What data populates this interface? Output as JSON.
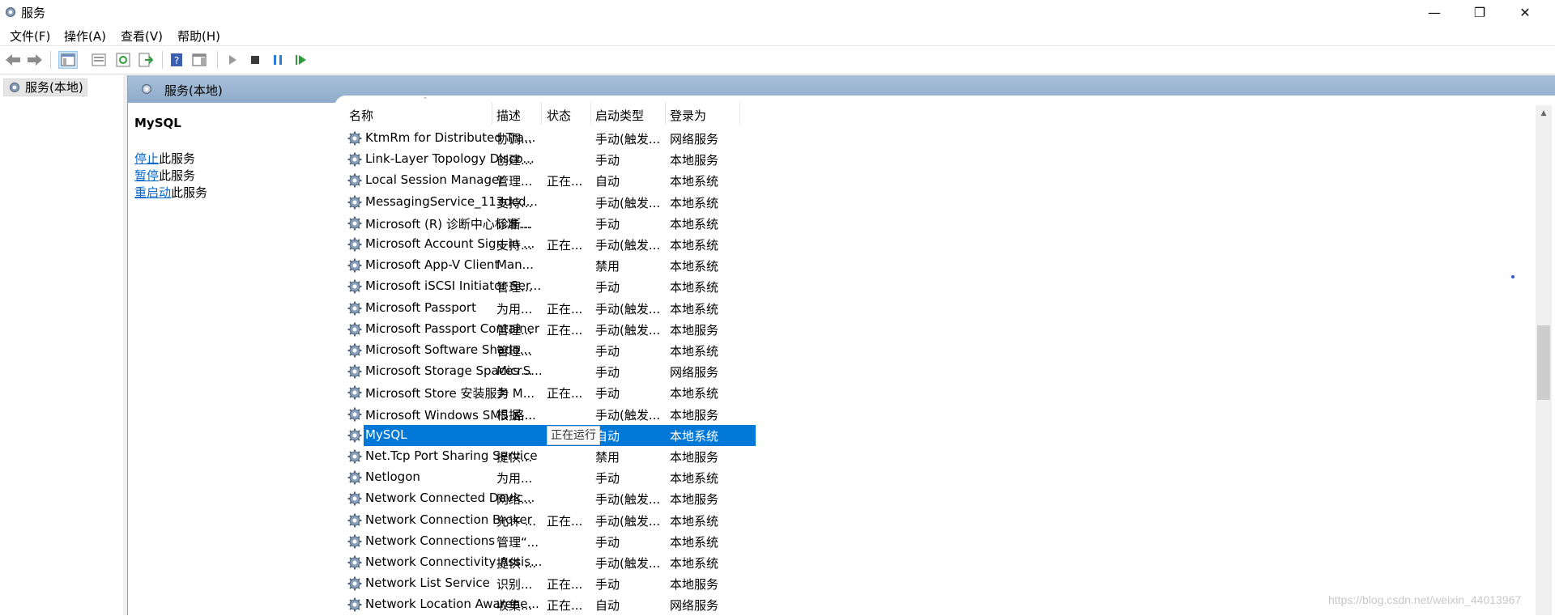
{
  "window": {
    "title": "服务",
    "min_icon": "minimize-icon",
    "max_icon": "restore-icon",
    "close_icon": "close-icon"
  },
  "menu": [
    "文件(F)",
    "操作(A)",
    "查看(V)",
    "帮助(H)"
  ],
  "toolbar_icons": [
    "back-arrow-icon",
    "forward-arrow-icon",
    "show-hide-console-tree-icon",
    "properties-icon",
    "refresh-icon",
    "export-list-icon",
    "help-icon",
    "show-action-pane-icon",
    "start-service-icon",
    "stop-service-icon",
    "pause-service-icon",
    "restart-service-icon"
  ],
  "tree": {
    "node_label": "服务(本地)"
  },
  "main": {
    "header_title": "服务(本地)",
    "selected_service_title": "MySQL",
    "actions": [
      {
        "link": "停止",
        "suffix": "此服务"
      },
      {
        "link": "暂停",
        "suffix": "此服务"
      },
      {
        "link": "重启动",
        "suffix": "此服务"
      }
    ]
  },
  "columns": [
    "名称",
    "描述",
    "状态",
    "启动类型",
    "登录为"
  ],
  "rows": [
    {
      "name": "KtmRm for Distributed Tra...",
      "desc": "协调...",
      "status": "",
      "start": "手动(触发...",
      "logon": "网络服务"
    },
    {
      "name": "Link-Layer Topology Disco...",
      "desc": "创建...",
      "status": "",
      "start": "手动",
      "logon": "本地服务"
    },
    {
      "name": "Local Session Manager",
      "desc": "管理...",
      "status": "正在...",
      "start": "自动",
      "logon": "本地系统"
    },
    {
      "name": "MessagingService_113dcd...",
      "desc": "支持...",
      "status": "",
      "start": "手动(触发...",
      "logon": "本地系统"
    },
    {
      "name": "Microsoft (R) 诊断中心标准...",
      "desc": "诊断...",
      "status": "",
      "start": "手动",
      "logon": "本地系统"
    },
    {
      "name": "Microsoft Account Sign-in ...",
      "desc": "支持...",
      "status": "正在...",
      "start": "手动(触发...",
      "logon": "本地系统"
    },
    {
      "name": "Microsoft App-V Client",
      "desc": "Man...",
      "status": "",
      "start": "禁用",
      "logon": "本地系统"
    },
    {
      "name": "Microsoft iSCSI Initiator Ser...",
      "desc": "管理...",
      "status": "",
      "start": "手动",
      "logon": "本地系统"
    },
    {
      "name": "Microsoft Passport",
      "desc": "为用...",
      "status": "正在...",
      "start": "手动(触发...",
      "logon": "本地系统"
    },
    {
      "name": "Microsoft Passport Container",
      "desc": "管理...",
      "status": "正在...",
      "start": "手动(触发...",
      "logon": "本地服务"
    },
    {
      "name": "Microsoft Software Shado...",
      "desc": "管理...",
      "status": "",
      "start": "手动",
      "logon": "本地系统"
    },
    {
      "name": "Microsoft Storage Spaces S...",
      "desc": "Micr...",
      "status": "",
      "start": "手动",
      "logon": "网络服务"
    },
    {
      "name": "Microsoft Store 安装服务",
      "desc": "为 M...",
      "status": "正在...",
      "start": "手动",
      "logon": "本地系统"
    },
    {
      "name": "Microsoft Windows SMS 路...",
      "desc": "根据...",
      "status": "",
      "start": "手动(触发...",
      "logon": "本地服务"
    },
    {
      "name": "MySQL",
      "desc": "",
      "status": "正在运行",
      "start": "自动",
      "logon": "本地系统",
      "selected": true
    },
    {
      "name": "Net.Tcp Port Sharing Service",
      "desc": "提供...",
      "status": "",
      "start": "禁用",
      "logon": "本地服务"
    },
    {
      "name": "Netlogon",
      "desc": "为用...",
      "status": "",
      "start": "手动",
      "logon": "本地系统"
    },
    {
      "name": "Network Connected Devic...",
      "desc": "网络...",
      "status": "",
      "start": "手动(触发...",
      "logon": "本地服务"
    },
    {
      "name": "Network Connection Broker",
      "desc": "允许 ...",
      "status": "正在...",
      "start": "手动(触发...",
      "logon": "本地系统"
    },
    {
      "name": "Network Connections",
      "desc": "管理“...",
      "status": "",
      "start": "手动",
      "logon": "本地系统"
    },
    {
      "name": "Network Connectivity Assis...",
      "desc": "提供 ...",
      "status": "",
      "start": "手动(触发...",
      "logon": "本地系统"
    },
    {
      "name": "Network List Service",
      "desc": "识别...",
      "status": "正在...",
      "start": "手动",
      "logon": "本地服务"
    },
    {
      "name": "Network Location Awarene...",
      "desc": "收集...",
      "status": "正在...",
      "start": "自动",
      "logon": "网络服务"
    }
  ],
  "watermark": "https://blog.csdn.net/weixin_44013967",
  "colors": {
    "selection": "#0078d7",
    "header": "#99b4d1",
    "link": "#0066cc"
  }
}
